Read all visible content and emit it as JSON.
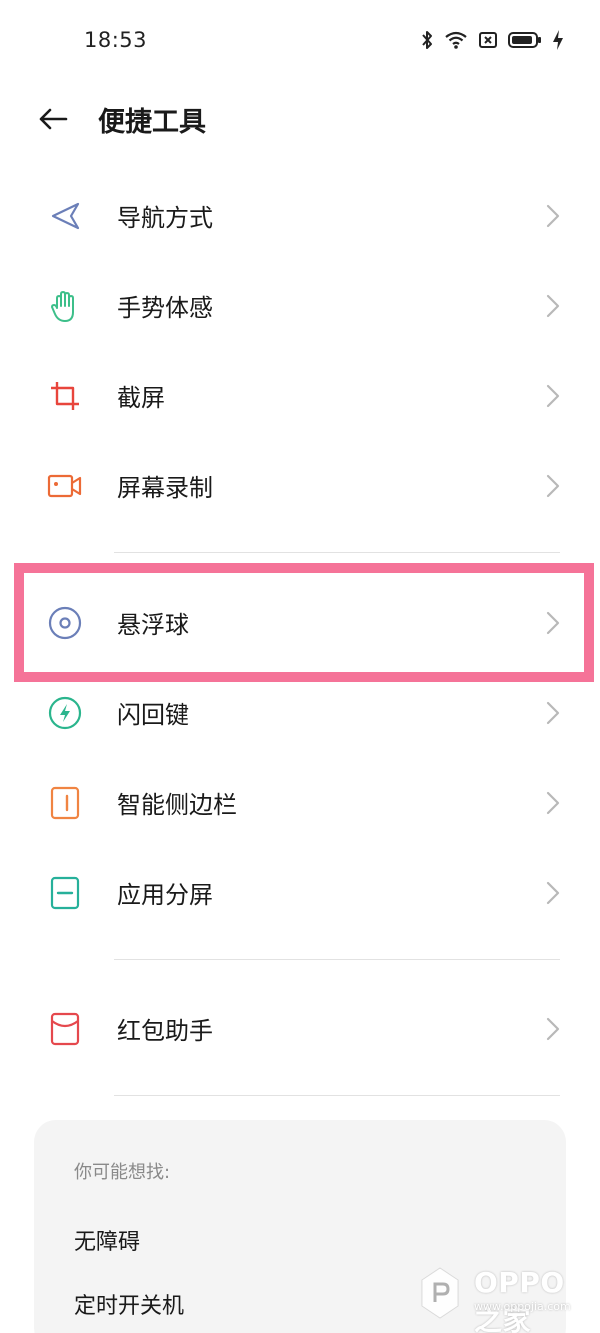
{
  "status_bar": {
    "time": "18:53",
    "icons": [
      "bluetooth-icon",
      "wifi-icon",
      "sim-off-icon",
      "battery-icon",
      "charging-icon"
    ]
  },
  "header": {
    "title": "便捷工具"
  },
  "items": [
    {
      "label": "导航方式",
      "icon": "navigation-arrow-icon",
      "color": "#6b7fb8"
    },
    {
      "label": "手势体感",
      "icon": "hand-gesture-icon",
      "color": "#3dbf8a"
    },
    {
      "label": "截屏",
      "icon": "crop-icon",
      "color": "#e8453c"
    },
    {
      "label": "屏幕录制",
      "icon": "video-camera-icon",
      "color": "#ec6a36"
    },
    {
      "label": "悬浮球",
      "icon": "floating-ball-icon",
      "color": "#6b7fb8"
    },
    {
      "label": "闪回键",
      "icon": "flash-icon",
      "color": "#2bb58d"
    },
    {
      "label": "智能侧边栏",
      "icon": "sidebar-icon",
      "color": "#f08442"
    },
    {
      "label": "应用分屏",
      "icon": "split-screen-icon",
      "color": "#26b09a"
    },
    {
      "label": "红包助手",
      "icon": "envelope-icon",
      "color": "#e5484d"
    }
  ],
  "suggestions": {
    "title": "你可能想找:",
    "links": [
      "无障碍",
      "定时开关机"
    ]
  },
  "watermark": {
    "main": "OPPO之家",
    "sub": "www.oppojia.com"
  },
  "colors": {
    "highlight": "#f57398",
    "chevron": "#b8b8b8",
    "divider": "#e2e2e2"
  }
}
